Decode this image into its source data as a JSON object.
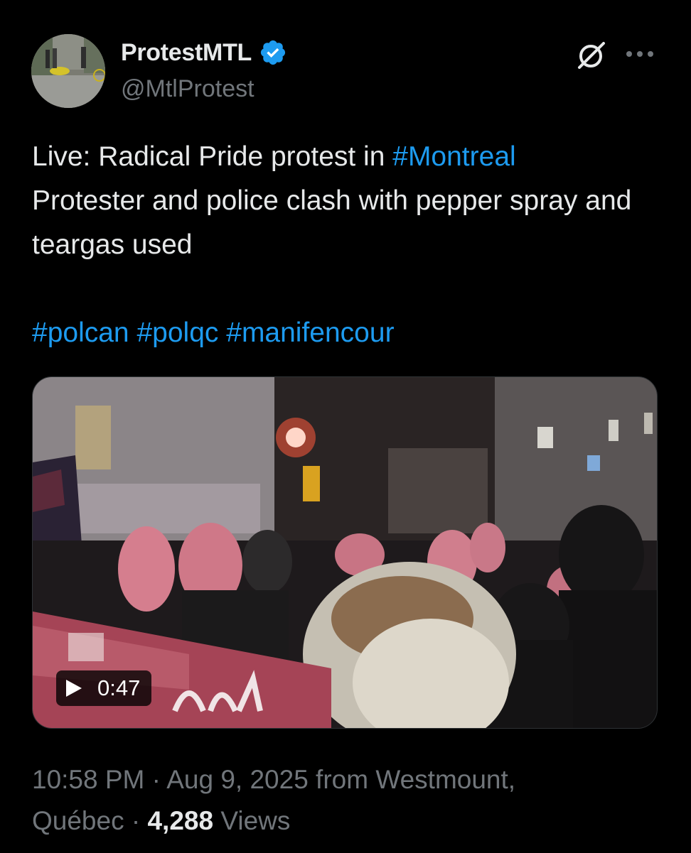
{
  "author": {
    "display_name": "ProtestMTL",
    "handle": "@MtlProtest",
    "verified": true,
    "verified_color": "#1d9bf0"
  },
  "header_actions": {
    "grok_icon": "grok-icon",
    "more_label": "···"
  },
  "tweet": {
    "line1_text": "Live: Radical Pride protest in ",
    "line1_hashtag": "#Montreal",
    "line2_text": "Protester and police clash with pepper spray and teargas used",
    "hashtags": {
      "h1": "#polcan",
      "h2": "#polqc",
      "h3": "#manifencour"
    },
    "hashtag_color": "#1d9bf0"
  },
  "media": {
    "type": "video",
    "duration": "0:47"
  },
  "meta": {
    "time": "10:58 PM",
    "separator": " · ",
    "date": "Aug 9, 2025",
    "source_prefix": " from ",
    "location_part1": "Westmount,",
    "location_part2": "Québec",
    "views_count": "4,288",
    "views_label": "Views"
  }
}
